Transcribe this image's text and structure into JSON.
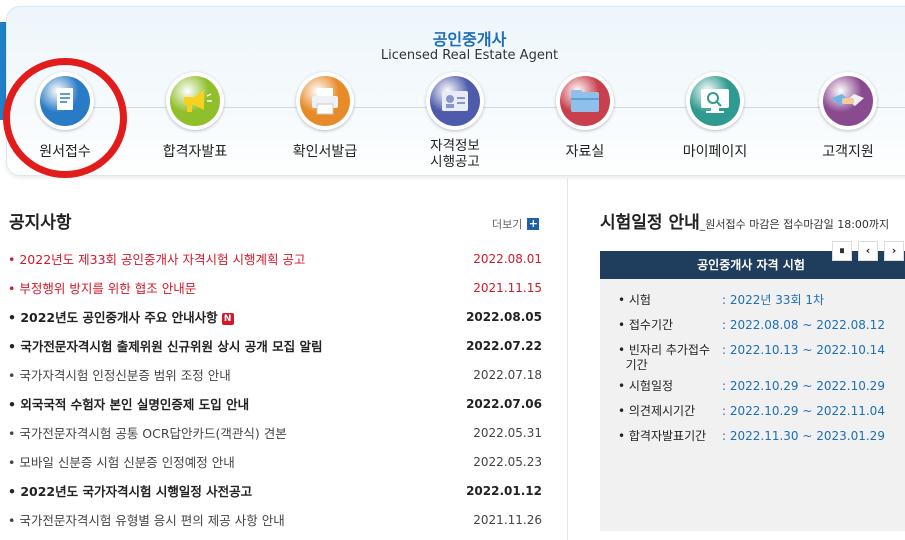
{
  "header": {
    "title": "공인중개사",
    "subtitle": "Licensed Real Estate Agent"
  },
  "services": [
    {
      "label": "원서접수",
      "icon": "document-icon",
      "color": "#2a7bc5"
    },
    {
      "label": "합격자발표",
      "icon": "megaphone-icon",
      "color": "#8fbf2a"
    },
    {
      "label": "확인서발급",
      "icon": "printer-icon",
      "color": "#e78b2a"
    },
    {
      "label": "자격정보\n시행공고",
      "icon": "id-card-icon",
      "color": "#4e5bab"
    },
    {
      "label": "자료실",
      "icon": "folder-icon",
      "color": "#c7404b"
    },
    {
      "label": "마이페이지",
      "icon": "monitor-icon",
      "color": "#2f9a8f"
    },
    {
      "label": "고객지원",
      "icon": "handshake-icon",
      "color": "#8a4a8f"
    }
  ],
  "notices": {
    "title": "공지사항",
    "more_label": "더보기",
    "new_badge": "N",
    "items": [
      {
        "text": "2022년도 제33회 공인중개사 자격시험 시행계획 공고",
        "date": "2022.08.01",
        "style": "red"
      },
      {
        "text": "부정행위 방지를 위한 협조 안내문",
        "date": "2021.11.15",
        "style": "red-light"
      },
      {
        "text": "2022년도 공인중개사 주요 안내사항",
        "date": "2022.08.05",
        "style": "bold",
        "badge": true
      },
      {
        "text": "국가전문자격시험 출제위원 신규위원 상시 공개 모집 알림",
        "date": "2022.07.22",
        "style": "bold"
      },
      {
        "text": "국가자격시험 인정신분증 범위 조정 안내",
        "date": "2022.07.18",
        "style": "normal"
      },
      {
        "text": "외국국적 수험자 본인 실명인증제 도입 안내",
        "date": "2022.07.06",
        "style": "bold"
      },
      {
        "text": "국가전문자격시험 공통 OCR답안카드(객관식) 견본",
        "date": "2022.05.31",
        "style": "normal"
      },
      {
        "text": "모바일 신분증 시험 신분증 인정예정 안내",
        "date": "2022.05.23",
        "style": "normal"
      },
      {
        "text": "2022년도 국가자격시험 시행일정 사전공고",
        "date": "2022.01.12",
        "style": "bold"
      },
      {
        "text": "국가전문자격시험 유형별 응시 편의 제공 사항 안내",
        "date": "2021.11.26",
        "style": "normal"
      }
    ]
  },
  "schedule": {
    "title": "시험일정 안내",
    "note": "_원서접수 마감은 접수마감일 18:00까지",
    "box_title": "공인중개사 자격 시험",
    "rows": [
      {
        "key": "시험",
        "value": "2022년 33회 1차"
      },
      {
        "key": "접수기간",
        "value": "2022.08.08 ~ 2022.08.12"
      },
      {
        "key": "빈자리 추가접수\n기간",
        "value": "2022.10.13 ~ 2022.10.14"
      },
      {
        "key": "시험일정",
        "value": "2022.10.29 ~ 2022.10.29"
      },
      {
        "key": "의견제시기간",
        "value": "2022.10.29 ~ 2022.11.04"
      },
      {
        "key": "합격자발표기간",
        "value": "2022.11.30 ~ 2023.01.29"
      }
    ],
    "controls": {
      "pause": "⏸",
      "prev": "‹",
      "next": "›"
    }
  }
}
